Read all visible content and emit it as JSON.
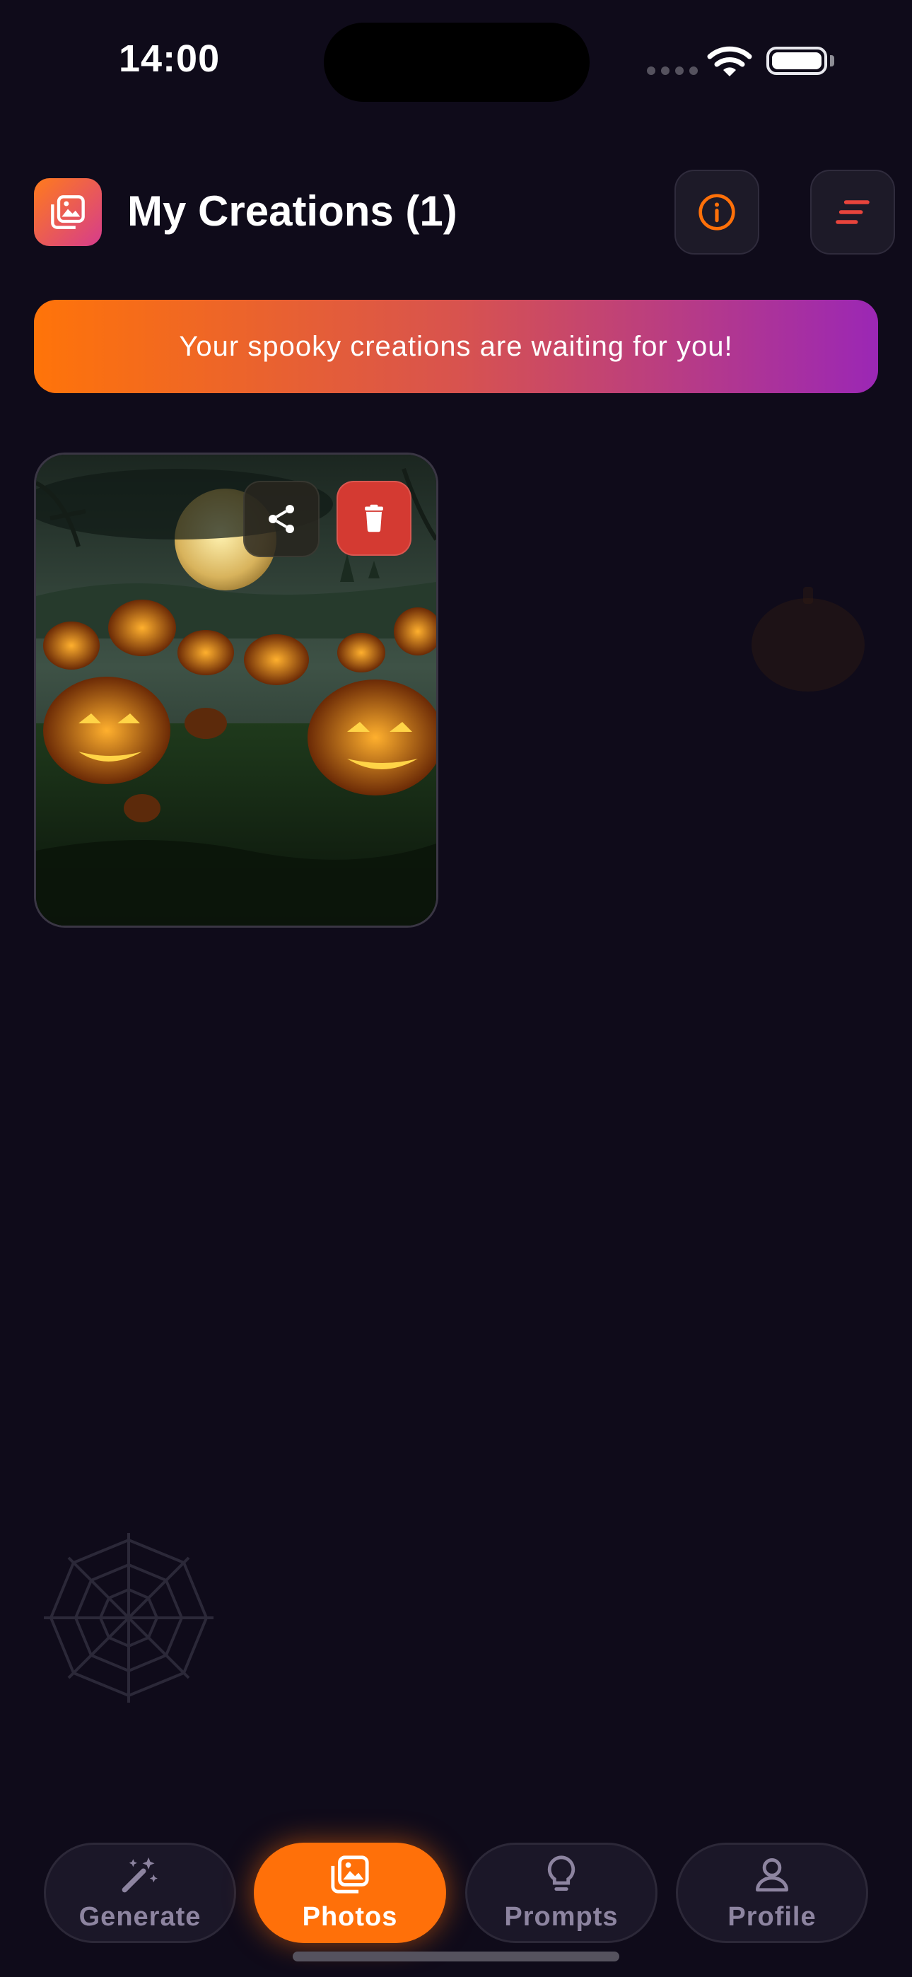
{
  "status_bar": {
    "time": "14:00"
  },
  "header": {
    "title": "My Creations (1)"
  },
  "banner": {
    "text": "Your spooky creations are waiting for you!"
  },
  "creations": [
    {
      "description_icon": "jack-o-lantern-image"
    }
  ],
  "icons": {
    "logo": "gallery-icon",
    "info": "info-icon",
    "sort": "sort-icon",
    "share": "share-icon",
    "delete": "trash-icon"
  },
  "tabs": [
    {
      "label": "Generate",
      "icon": "magic-wand-icon",
      "active": false
    },
    {
      "label": "Photos",
      "icon": "gallery-icon",
      "active": true
    },
    {
      "label": "Prompts",
      "icon": "lightbulb-icon",
      "active": false
    },
    {
      "label": "Profile",
      "icon": "user-icon",
      "active": false
    }
  ],
  "colors": {
    "background": "#0f0b1a",
    "accent": "#ff7009",
    "banner_start": "#ff7409",
    "banner_end": "#9b27b5",
    "delete": "#d43a32"
  }
}
